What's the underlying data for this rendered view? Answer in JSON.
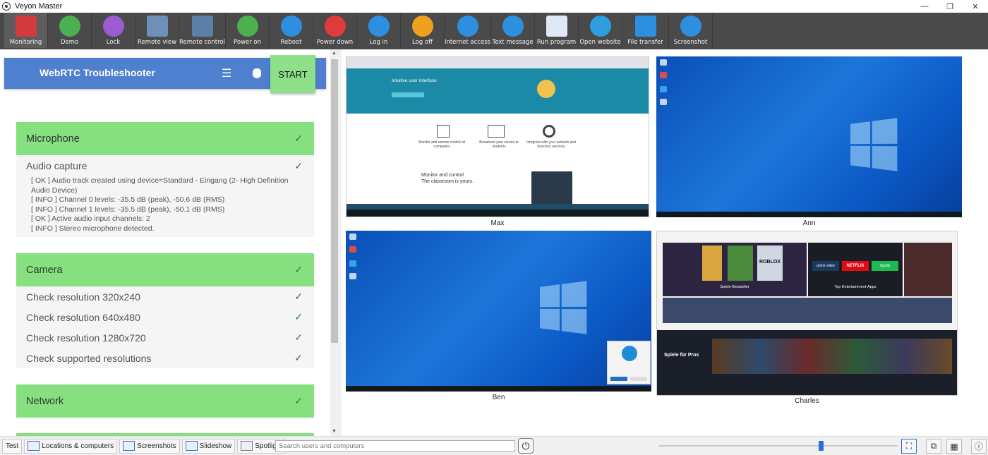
{
  "window": {
    "title": "Veyon Master",
    "minimize": "—",
    "maximize": "❐",
    "close": "✕"
  },
  "toolbar": {
    "items": [
      {
        "label": "Monitoring",
        "icon": "monitoring-icon",
        "color": "#d23b3b",
        "active": true
      },
      {
        "label": "Demo",
        "icon": "demo-icon",
        "color": "#4caf50"
      },
      {
        "label": "Lock",
        "icon": "lock-icon",
        "color": "#9c5bd1"
      },
      {
        "label": "Remote view",
        "icon": "remote-view-icon",
        "color": "#6d8fb8"
      },
      {
        "label": "Remote control",
        "icon": "remote-control-icon",
        "color": "#5b7fa8"
      },
      {
        "label": "Power on",
        "icon": "power-on-icon",
        "color": "#4caf50"
      },
      {
        "label": "Reboot",
        "icon": "reboot-icon",
        "color": "#2d8fe0"
      },
      {
        "label": "Power down",
        "icon": "power-down-icon",
        "color": "#e03b3b"
      },
      {
        "label": "Log in",
        "icon": "login-icon",
        "color": "#2d8fe0"
      },
      {
        "label": "Log off",
        "icon": "logoff-icon",
        "color": "#f0a020"
      },
      {
        "label": "Internet access",
        "icon": "internet-access-icon",
        "color": "#2d8fe0"
      },
      {
        "label": "Text message",
        "icon": "text-message-icon",
        "color": "#2d8fe0"
      },
      {
        "label": "Run program",
        "icon": "run-program-icon",
        "color": "#dfe9f5"
      },
      {
        "label": "Open website",
        "icon": "open-website-icon",
        "color": "#2d9fe0"
      },
      {
        "label": "File transfer",
        "icon": "file-transfer-icon",
        "color": "#2d8fe0"
      },
      {
        "label": "Screenshot",
        "icon": "screenshot-icon",
        "color": "#2d8fe0"
      }
    ]
  },
  "webrtc": {
    "title": "WebRTC Troubleshooter",
    "start_label": "START",
    "sections": [
      {
        "title": "Microphone",
        "rows": [
          {
            "label": "Audio capture"
          }
        ],
        "log": [
          "[ OK ] Audio track created using device=Standard - Eingang (2- High Definition Audio Device)",
          "[ INFO ] Channel 0 levels: -35.5 dB (peak), -50.6 dB (RMS)",
          "[ INFO ] Channel 1 levels: -35.5 dB (peak), -50.1 dB (RMS)",
          "[ OK ] Active audio input channels: 2",
          "[ INFO ] Stereo microphone detected."
        ]
      },
      {
        "title": "Camera",
        "rows": [
          {
            "label": "Check resolution 320x240"
          },
          {
            "label": "Check resolution 640x480"
          },
          {
            "label": "Check resolution 1280x720"
          },
          {
            "label": "Check supported resolutions"
          }
        ]
      },
      {
        "title": "Network",
        "rows": []
      }
    ],
    "check_glyph": "✓"
  },
  "computers": [
    {
      "name": "Max"
    },
    {
      "name": "Ann"
    },
    {
      "name": "Ben"
    },
    {
      "name": "Charles"
    }
  ],
  "max_screen": {
    "headline": "Intuitive user interface",
    "feature1": "Monitor and remote control all computers",
    "feature2": "Broadcast your screen to students",
    "feature3": "Integrate with your network and directory services",
    "section": "Monitor and control",
    "subsection": "The classroom is yours."
  },
  "charles_screen": {
    "tile1": "Spiele-Bestseller",
    "tile2": "Top Entertainment-Apps",
    "banner": "Spiele für Pros",
    "brand1": "prime video",
    "brand2": "NETFLIX",
    "brand3": "Spotify",
    "brand4": "ROBLOX"
  },
  "statusbar": {
    "test_label": "Test",
    "locations_label": "Locations & computers",
    "screenshots_label": "Screenshots",
    "slideshow_label": "Slideshow",
    "spotlight_label": "Spotlight",
    "search_placeholder": "Search users and computers",
    "zoom_fraction": 0.67
  }
}
